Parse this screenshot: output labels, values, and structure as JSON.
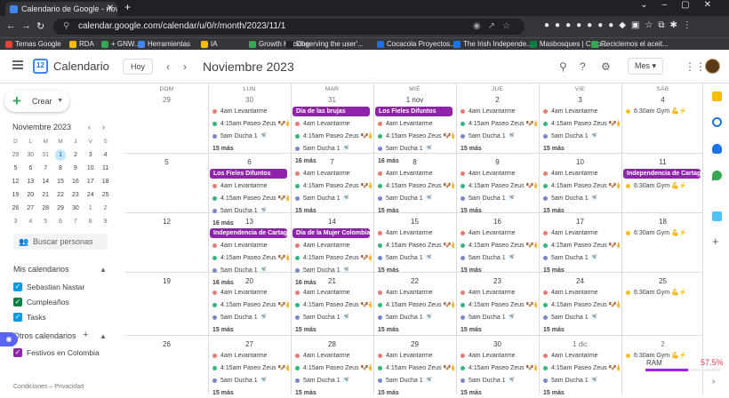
{
  "browser": {
    "tab_title": "Calendario de Google - noviembre",
    "url": "calendar.google.com/calendar/u/0/r/month/2023/11/1",
    "bookmarks": [
      "Temas Google",
      "RDA",
      "+ GNW...",
      "Herramientas",
      "IA",
      "Growth Hacking",
      "Observing the user'...",
      "Cocacola Proyectos...",
      "The Irish Independe...",
      "Masbosques | Corp...",
      "Reciclemos el aceit..."
    ]
  },
  "header": {
    "app_name": "Calendario",
    "logo_day": "12",
    "today_label": "Hoy",
    "month_title": "Noviembre 2023",
    "view_label": "Mes"
  },
  "sidebar": {
    "create_label": "Crear",
    "mini_title": "Noviembre 2023",
    "mini_dow": [
      "D",
      "L",
      "M",
      "M",
      "J",
      "V",
      "S"
    ],
    "mini_weeks": [
      [
        "29",
        "30",
        "31",
        "1",
        "2",
        "3",
        "4"
      ],
      [
        "5",
        "6",
        "7",
        "8",
        "9",
        "10",
        "11"
      ],
      [
        "12",
        "13",
        "14",
        "15",
        "16",
        "17",
        "18"
      ],
      [
        "19",
        "20",
        "21",
        "22",
        "23",
        "24",
        "25"
      ],
      [
        "26",
        "27",
        "28",
        "29",
        "30",
        "1",
        "2"
      ],
      [
        "3",
        "4",
        "5",
        "6",
        "7",
        "8",
        "9"
      ]
    ],
    "search_people": "Buscar personas",
    "my_calendars_title": "Mis calendarios",
    "my_calendars": [
      {
        "label": "Sebastian Nastar",
        "color": "#039be5"
      },
      {
        "label": "Cumpleaños",
        "color": "#0b8043"
      },
      {
        "label": "Tasks",
        "color": "#039be5"
      }
    ],
    "other_calendars_title": "Otros calendarios",
    "other_calendars": [
      {
        "label": "Festivos en Colombia",
        "color": "#8e24aa"
      }
    ],
    "footer": "Condiciones – Privacidad"
  },
  "calendar": {
    "dow": [
      "DOM",
      "LUN",
      "MAR",
      "MIÉ",
      "JUE",
      "VIE",
      "SÁB"
    ],
    "weeks": [
      {
        "days": [
          "29",
          "30",
          "31",
          "1 nov",
          "2",
          "3",
          "4"
        ]
      },
      {
        "days": [
          "5",
          "6",
          "7",
          "8",
          "9",
          "10",
          "11"
        ]
      },
      {
        "days": [
          "12",
          "13",
          "14",
          "15",
          "16",
          "17",
          "18"
        ]
      },
      {
        "days": [
          "19",
          "20",
          "21",
          "22",
          "23",
          "24",
          "25"
        ]
      },
      {
        "days": [
          "26",
          "27",
          "28",
          "29",
          "30",
          "1 dic",
          "2"
        ]
      }
    ],
    "holidays": [
      {
        "label": "Día de las brujas"
      },
      {
        "label": "Los Fieles Difuntos"
      },
      {
        "label": "Los Fieles Difuntos"
      },
      {
        "label": "Independencia de Cartagen"
      },
      {
        "label": "Independencia de Cartagen"
      },
      {
        "label": "Día de la Mujer Colombiana"
      }
    ],
    "event_wake": {
      "time": "4am",
      "title": "Levantarme",
      "color": "#e67c73"
    },
    "event_walk": {
      "time": "4:15am",
      "title": "Paseo Zeus 🐶👑",
      "color": "#33b679"
    },
    "event_shower": {
      "time": "5am",
      "title": "Ducha 1 🚿",
      "color": "#7986cb"
    },
    "event_gym": {
      "time": "6:30am",
      "title": "Gym 💪⚡",
      "color": "#f6bf26"
    },
    "more_15": "15 más",
    "more_16": "16 más"
  },
  "ram": {
    "label": "RAM",
    "value": "57.5%",
    "fraction": 0.575
  }
}
